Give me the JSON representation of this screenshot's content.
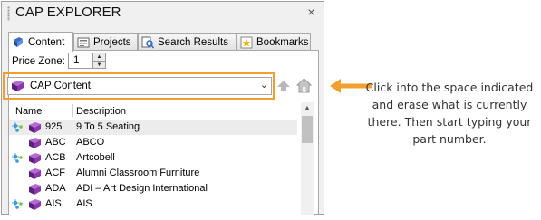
{
  "panel": {
    "title": "CAP EXPLORER",
    "close_glyph": "×"
  },
  "tabs": [
    {
      "label": "Content",
      "icon": "book-icon",
      "active": true
    },
    {
      "label": "Projects",
      "icon": "projects-icon",
      "active": false
    },
    {
      "label": "Search Results",
      "icon": "search-results-icon",
      "active": false
    },
    {
      "label": "Bookmarks",
      "icon": "bookmark-icon",
      "active": false
    }
  ],
  "price_zone": {
    "label": "Price Zone:",
    "value": "1"
  },
  "content_select": {
    "value": "CAP Content"
  },
  "list": {
    "columns": [
      "Name",
      "Description"
    ],
    "rows": [
      {
        "name": "925",
        "description": "9 To 5 Seating",
        "starred": true
      },
      {
        "name": "ABC",
        "description": "ABCO",
        "starred": false
      },
      {
        "name": "ACB",
        "description": "Artcobell",
        "starred": true
      },
      {
        "name": "ACF",
        "description": "Alumni Classroom Furniture",
        "starred": false
      },
      {
        "name": "ADA",
        "description": "ADI – Art Design International",
        "starred": false
      },
      {
        "name": "AIS",
        "description": "AIS",
        "starred": true
      }
    ]
  },
  "callout": {
    "text": "Click into the space indicated and erase what is currently there. Then start typing your part number."
  },
  "colors": {
    "highlight": "#f0a030",
    "book": "#6a2a8a",
    "star": "#3a9ad8"
  }
}
